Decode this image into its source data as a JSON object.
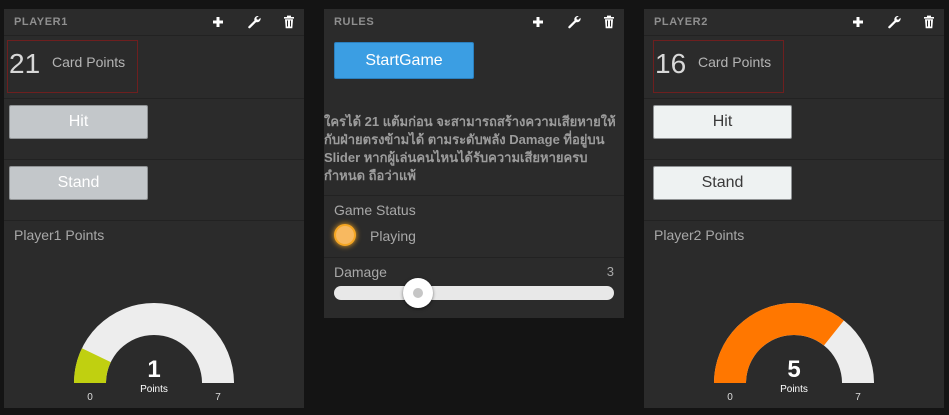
{
  "player1": {
    "title": "PLAYER1",
    "card_points_value": "21",
    "card_points_label": "Card Points",
    "hit_label": "Hit",
    "stand_label": "Stand",
    "points_heading": "Player1 Points",
    "gauge": {
      "value": 1,
      "min": 0,
      "max": 7,
      "value_text": "1",
      "min_text": "0",
      "max_text": "7",
      "units": "Points",
      "fill_color": "#c0d010",
      "track_color": "#ededed"
    }
  },
  "rules": {
    "title": "RULES",
    "start_label": "StartGame",
    "description": "ใครได้ 21 แต้มก่อน จะสามารถสร้างความเสียหายให้กับฝ่ายตรงข้ามได้ ตามระดับพลัง Damage ที่อยู่บน Slider หากผู้เล่นคนไหนได้รับความเสียหายครบกำหนด ถือว่าแพ้",
    "status_heading": "Game Status",
    "status_text": "Playing",
    "status_color": "#f5a623",
    "damage_label": "Damage",
    "damage_value": "3",
    "damage_level": 3,
    "damage_min": 0,
    "damage_max": 10
  },
  "player2": {
    "title": "PLAYER2",
    "card_points_value": "16",
    "card_points_label": "Card Points",
    "hit_label": "Hit",
    "stand_label": "Stand",
    "points_heading": "Player2 Points",
    "gauge": {
      "value": 5,
      "min": 0,
      "max": 7,
      "value_text": "5",
      "min_text": "0",
      "max_text": "7",
      "units": "Points",
      "fill_color": "#ff7700",
      "track_color": "#ededed"
    }
  },
  "icons": {
    "add": "plus-icon",
    "settings": "wrench-icon",
    "delete": "trash-icon"
  }
}
